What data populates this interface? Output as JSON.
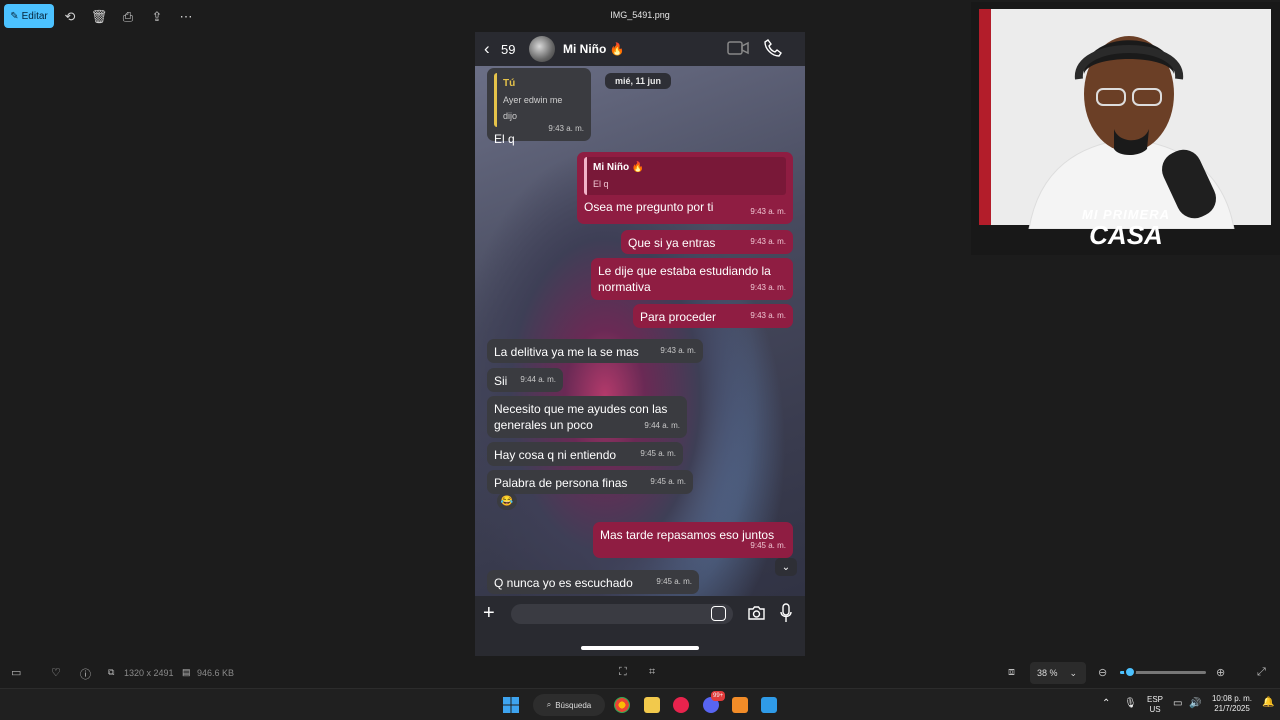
{
  "toolbar": {
    "edit_label": "Editar",
    "file_title": "IMG_5491.png",
    "icons": [
      "rotate-icon",
      "delete-icon",
      "print-icon",
      "share-icon",
      "more-icon"
    ]
  },
  "chat": {
    "back_count": "59",
    "contact_name": "Mi Niño 🔥",
    "date_chip": "mié, 11 jun",
    "messages": [
      {
        "dir": "in",
        "quote_name": "Tú",
        "quote_text": "Ayer edwin me dijo",
        "text": "El q",
        "time": "9:43 a. m."
      },
      {
        "dir": "out",
        "quote_name": "Mi Niño 🔥",
        "quote_text": "El q",
        "text": "Osea me pregunto por ti",
        "time": "9:43 a. m."
      },
      {
        "dir": "out",
        "text": "Que si ya entras",
        "time": "9:43 a. m."
      },
      {
        "dir": "out",
        "text": "Le dije que estaba estudiando la normativa",
        "time": "9:43 a. m."
      },
      {
        "dir": "out",
        "text": "Para proceder",
        "time": "9:43 a. m."
      },
      {
        "dir": "in",
        "text": "La delitiva ya me la se mas",
        "time": "9:43 a. m."
      },
      {
        "dir": "in",
        "text": "Sii",
        "time": "9:44 a. m."
      },
      {
        "dir": "in",
        "text": "Necesito que me ayudes con las generales un poco",
        "time": "9:44 a. m."
      },
      {
        "dir": "in",
        "text": "Hay cosa q ni entiendo",
        "time": "9:45 a. m."
      },
      {
        "dir": "in",
        "text": "Palabra de persona finas",
        "time": "9:45 a. m.",
        "reaction": "😂"
      },
      {
        "dir": "out",
        "text": "Mas tarde repasamos eso juntos",
        "time": "9:45 a. m."
      },
      {
        "dir": "in",
        "text": "Q nunca yo es escuchado",
        "time": "9:45 a. m."
      }
    ]
  },
  "webcam": {
    "logo_line1": "MI PRIMERA",
    "logo_line2": "CASA"
  },
  "infobar": {
    "dimensions": "1320 x 2491",
    "file_size": "946.6 KB",
    "zoom": "38 %",
    "zoom_value": 0.1
  },
  "taskbar": {
    "search_label": "Búsqueda",
    "lang_top": "ESP",
    "lang_bottom": "US",
    "time": "10:08 p. m.",
    "date": "21/7/2025",
    "badge": "99+"
  },
  "colors": {
    "accent": "#4cc2ff",
    "outgoing_bubble": "#8f1d42",
    "incoming_bubble": "#3a3b40"
  }
}
